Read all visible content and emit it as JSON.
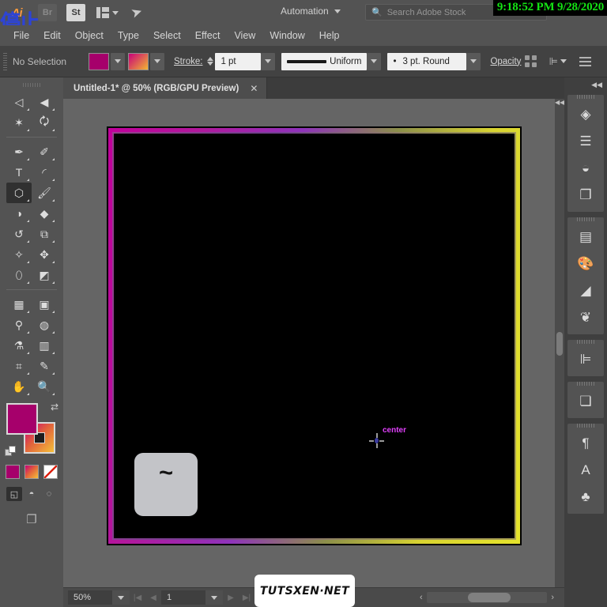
{
  "app": {
    "logo_text": "Ai",
    "overlay_cjk": "停止",
    "timestamp": "9:18:52 PM 9/28/2020",
    "buttons": [
      {
        "label": "Br",
        "name": "bridge-button"
      },
      {
        "label": "St",
        "name": "stock-button"
      }
    ],
    "arrange_label": "arrange-documents",
    "automation": "Automation",
    "search_placeholder": "Search Adobe Stock",
    "search_value": ""
  },
  "menu": {
    "items": [
      "File",
      "Edit",
      "Object",
      "Type",
      "Select",
      "Effect",
      "View",
      "Window",
      "Help"
    ]
  },
  "control_bar": {
    "selection_status": "No Selection",
    "fill_color": "#a6006b",
    "stroke_gradient_from": "#c8007a",
    "stroke_gradient_to": "#f2b632",
    "stroke_label": "Stroke:",
    "stroke_weight": "1 pt",
    "profile_label": "Uniform",
    "brush_label": "3 pt. Round",
    "opacity_label": "Opacity"
  },
  "document": {
    "tab_title": "Untitled-1* @ 50% (RGB/GPU Preview)",
    "close_glyph": "✕"
  },
  "toolbar": {
    "tools": [
      {
        "name": "selection-tool",
        "glyph": "◁",
        "active": false
      },
      {
        "name": "direct-selection-tool",
        "glyph": "◀",
        "active": false
      },
      {
        "name": "magic-wand-tool",
        "glyph": "✶",
        "active": false
      },
      {
        "name": "lasso-tool",
        "glyph": "🗘",
        "active": false
      },
      {
        "name": "pen-tool",
        "glyph": "✒",
        "active": false
      },
      {
        "name": "curvature-tool",
        "glyph": "✐",
        "active": false
      },
      {
        "name": "type-tool",
        "glyph": "T",
        "active": false
      },
      {
        "name": "line-segment-tool",
        "glyph": "◜",
        "active": false
      },
      {
        "name": "shape-tool",
        "glyph": "⬡",
        "active": true
      },
      {
        "name": "paintbrush-tool",
        "glyph": "🖌",
        "active": false
      },
      {
        "name": "shaper-tool",
        "glyph": "◑",
        "active": false
      },
      {
        "name": "eraser-tool",
        "glyph": "◆",
        "active": false
      },
      {
        "name": "rotate-tool",
        "glyph": "↺",
        "active": false
      },
      {
        "name": "scale-tool",
        "glyph": "⧉",
        "active": false
      },
      {
        "name": "width-tool",
        "glyph": "✧",
        "active": false
      },
      {
        "name": "free-transform-tool",
        "glyph": "✥",
        "active": false
      },
      {
        "name": "shape-builder-tool",
        "glyph": "⬯",
        "active": false
      },
      {
        "name": "perspective-grid-tool",
        "glyph": "◩",
        "active": false
      },
      {
        "name": "mesh-tool",
        "glyph": "▦",
        "active": false
      },
      {
        "name": "gradient-tool",
        "glyph": "▣",
        "active": false
      },
      {
        "name": "eyedropper-tool",
        "glyph": "⚲",
        "active": false
      },
      {
        "name": "blend-tool",
        "glyph": "◍",
        "active": false
      },
      {
        "name": "symbol-sprayer-tool",
        "glyph": "⚗",
        "active": false
      },
      {
        "name": "column-graph-tool",
        "glyph": "▥",
        "active": false
      },
      {
        "name": "artboard-tool",
        "glyph": "⌗",
        "active": false
      },
      {
        "name": "slice-tool",
        "glyph": "✎",
        "active": false
      },
      {
        "name": "hand-tool",
        "glyph": "✋",
        "active": false
      },
      {
        "name": "zoom-tool",
        "glyph": "🔍",
        "active": false
      }
    ],
    "fill_color": "#a6006b",
    "stroke_gradient": "linear-gradient(135deg,#c8007a 0%,#e2603c 45%,#f5c03a 100%)",
    "swap_glyph": "⇄",
    "swatch_modes": [
      {
        "name": "color-swatch",
        "color": "#a6006b"
      },
      {
        "name": "gradient-swatch",
        "color": "gradient"
      },
      {
        "name": "none-swatch",
        "color": "#ffffff"
      }
    ],
    "draw_modes": [
      {
        "name": "draw-normal-mode",
        "glyph": "◱",
        "active": true
      },
      {
        "name": "draw-behind-mode",
        "glyph": "◓",
        "active": false
      },
      {
        "name": "draw-inside-mode",
        "glyph": "◌",
        "active": false
      }
    ],
    "screen_mode_glyph": "❐"
  },
  "canvas": {
    "artwork_fill": "#000000",
    "border_gradient_from": "#c1009b",
    "border_gradient_to": "#e4e22c",
    "smart_guide_label": "center",
    "smart_guide_color": "#e040fb",
    "key_overlay": "~"
  },
  "right_panel": {
    "collapse_glyph": "◀◀",
    "groups": [
      {
        "name": "panel-group-layers",
        "items": [
          {
            "name": "layers-panel-icon",
            "glyph": "◈"
          },
          {
            "name": "libraries-panel-icon",
            "glyph": "☰"
          },
          {
            "name": "appearance-panel-icon",
            "glyph": "◒"
          },
          {
            "name": "artboards-panel-icon",
            "glyph": "❐"
          }
        ]
      },
      {
        "name": "panel-group-color",
        "items": [
          {
            "name": "gradient-panel-icon",
            "glyph": "▤"
          },
          {
            "name": "color-panel-icon",
            "glyph": "🎨"
          },
          {
            "name": "color-guide-panel-icon",
            "glyph": "◢"
          },
          {
            "name": "brushes-panel-icon",
            "glyph": "❦"
          }
        ]
      },
      {
        "name": "panel-group-align",
        "items": [
          {
            "name": "align-panel-icon",
            "glyph": "⊫"
          }
        ]
      },
      {
        "name": "panel-group-pathfinder",
        "items": [
          {
            "name": "pathfinder-panel-icon",
            "glyph": "❏"
          }
        ]
      },
      {
        "name": "panel-group-type",
        "items": [
          {
            "name": "paragraph-panel-icon",
            "glyph": "¶"
          },
          {
            "name": "character-panel-icon",
            "glyph": "A"
          },
          {
            "name": "symbols-panel-icon",
            "glyph": "♣"
          }
        ]
      }
    ]
  },
  "status_bar": {
    "zoom_level": "50%",
    "page_number": "1",
    "first_glyph": "|◀",
    "prev_glyph": "◀",
    "next_glyph": "▶",
    "last_glyph": "▶|",
    "scroll_left_glyph": "‹",
    "scroll_right_glyph": "›"
  },
  "watermark": {
    "text": "TUTSXEN·NET"
  }
}
